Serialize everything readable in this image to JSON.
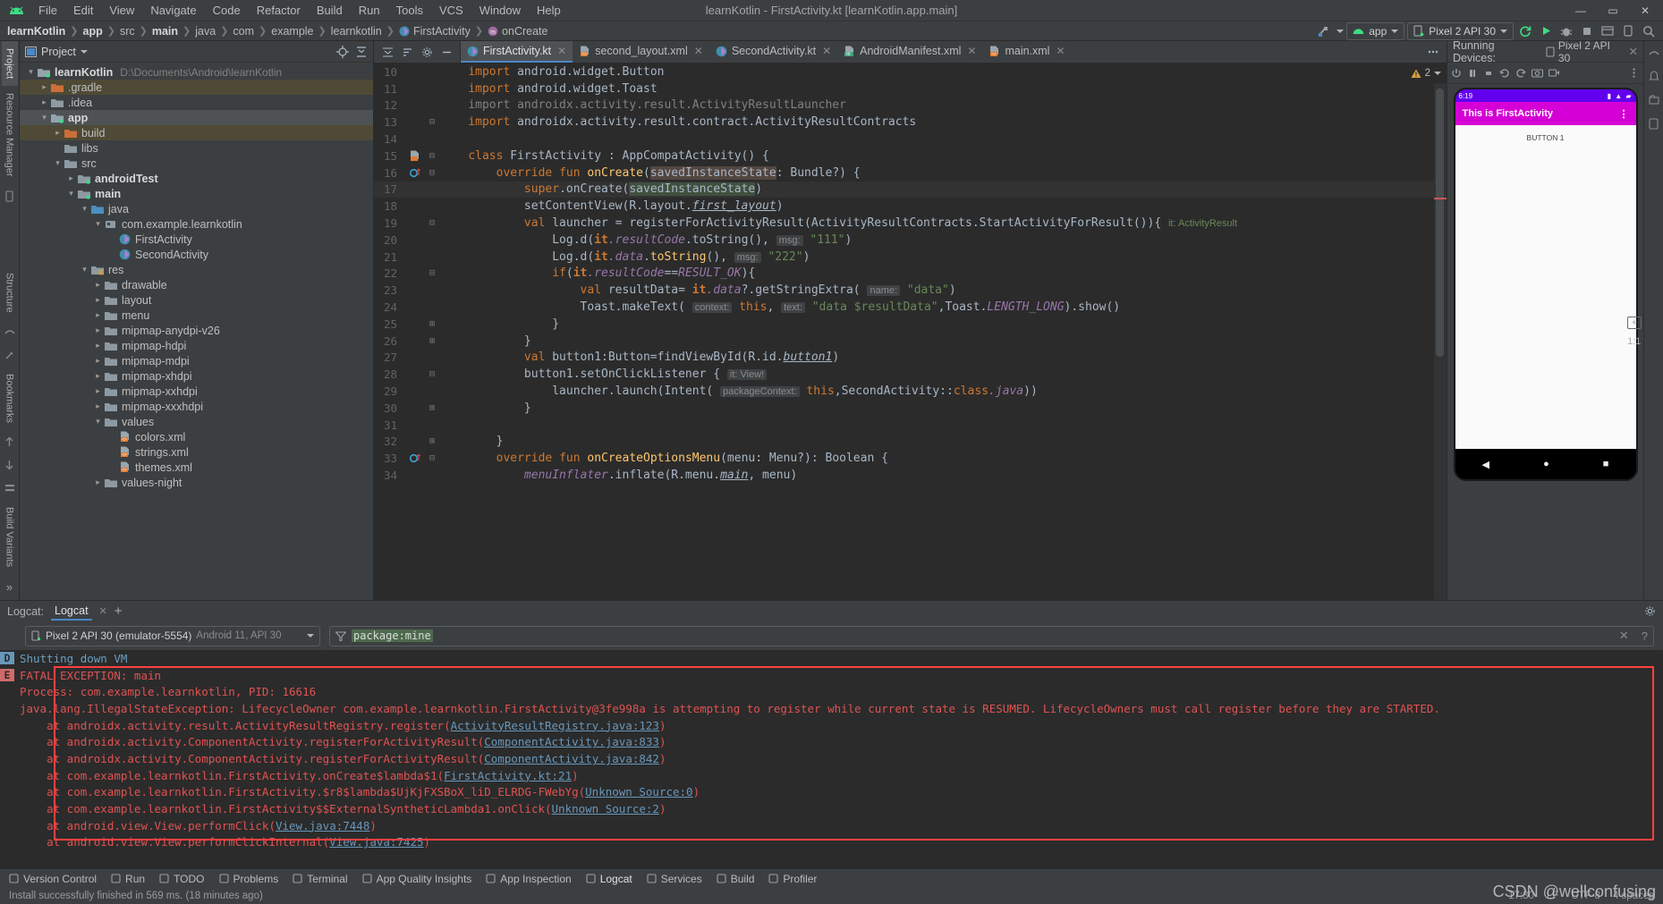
{
  "window": {
    "title": "learnKotlin - FirstActivity.kt [learnKotlin.app.main]",
    "minimize": "—",
    "maximize": "▭",
    "close": "✕"
  },
  "menu": [
    {
      "label": "File"
    },
    {
      "label": "Edit"
    },
    {
      "label": "View"
    },
    {
      "label": "Navigate"
    },
    {
      "label": "Code"
    },
    {
      "label": "Refactor"
    },
    {
      "label": "Build"
    },
    {
      "label": "Run"
    },
    {
      "label": "Tools"
    },
    {
      "label": "VCS"
    },
    {
      "label": "Window"
    },
    {
      "label": "Help"
    }
  ],
  "breadcrumb": [
    {
      "label": "learnKotlin",
      "bold": true
    },
    {
      "label": "app",
      "bold": true
    },
    {
      "label": "src",
      "bold": false
    },
    {
      "label": "main",
      "bold": true
    },
    {
      "label": "java",
      "bold": false
    },
    {
      "label": "com",
      "bold": false
    },
    {
      "label": "example",
      "bold": false
    },
    {
      "label": "learnkotlin",
      "bold": false
    },
    {
      "label": "FirstActivity",
      "bold": false
    },
    {
      "label": "onCreate",
      "bold": false
    }
  ],
  "toolbar": {
    "run_config": "app",
    "device": "Pixel 2 API 30",
    "sync_icon": "gradle-sync-icon",
    "run_icon": "run-icon",
    "debug_icon": "debug-icon",
    "search_icon": "search-icon"
  },
  "left_strip": [
    {
      "label": "Project",
      "selected": true
    },
    {
      "label": "Resource Manager",
      "selected": false
    }
  ],
  "bottom_left_strip": [
    {
      "label": "Structure"
    },
    {
      "label": "Bookmarks"
    },
    {
      "label": "Build Variants"
    }
  ],
  "project": {
    "title": "Project",
    "tree": [
      {
        "indent": 0,
        "arrow": "v",
        "icon": "module-icon",
        "label": "learnKotlin",
        "bold": true,
        "path": "D:\\Documents\\Android\\learnKotlin",
        "state": "normal"
      },
      {
        "indent": 1,
        "arrow": ">",
        "icon": "folder-excluded-icon",
        "label": ".gradle",
        "bold": false,
        "path": "",
        "state": "hl"
      },
      {
        "indent": 1,
        "arrow": ">",
        "icon": "folder-icon",
        "label": ".idea",
        "bold": false,
        "path": "",
        "state": "normal"
      },
      {
        "indent": 1,
        "arrow": "v",
        "icon": "module-icon",
        "label": "app",
        "bold": true,
        "path": "",
        "state": "sel"
      },
      {
        "indent": 2,
        "arrow": ">",
        "icon": "folder-excluded-icon",
        "label": "build",
        "bold": false,
        "path": "",
        "state": "hl"
      },
      {
        "indent": 2,
        "arrow": "",
        "icon": "folder-icon",
        "label": "libs",
        "bold": false,
        "path": "",
        "state": "normal"
      },
      {
        "indent": 2,
        "arrow": "v",
        "icon": "folder-icon",
        "label": "src",
        "bold": false,
        "path": "",
        "state": "normal"
      },
      {
        "indent": 3,
        "arrow": ">",
        "icon": "source-folder-icon",
        "label": "androidTest",
        "bold": true,
        "path": "",
        "state": "normal"
      },
      {
        "indent": 3,
        "arrow": "v",
        "icon": "source-folder-icon",
        "label": "main",
        "bold": true,
        "path": "",
        "state": "normal"
      },
      {
        "indent": 4,
        "arrow": "v",
        "icon": "java-folder-icon",
        "label": "java",
        "bold": false,
        "path": "",
        "state": "normal"
      },
      {
        "indent": 5,
        "arrow": "v",
        "icon": "package-icon",
        "label": "com.example.learnkotlin",
        "bold": false,
        "path": "",
        "state": "normal"
      },
      {
        "indent": 6,
        "arrow": "",
        "icon": "kotlin-class-icon",
        "label": "FirstActivity",
        "bold": false,
        "path": "",
        "state": "normal"
      },
      {
        "indent": 6,
        "arrow": "",
        "icon": "kotlin-class-icon",
        "label": "SecondActivity",
        "bold": false,
        "path": "",
        "state": "normal"
      },
      {
        "indent": 4,
        "arrow": "v",
        "icon": "res-folder-icon",
        "label": "res",
        "bold": false,
        "path": "",
        "state": "normal"
      },
      {
        "indent": 5,
        "arrow": ">",
        "icon": "folder-icon",
        "label": "drawable",
        "bold": false,
        "path": "",
        "state": "normal"
      },
      {
        "indent": 5,
        "arrow": ">",
        "icon": "folder-icon",
        "label": "layout",
        "bold": false,
        "path": "",
        "state": "normal"
      },
      {
        "indent": 5,
        "arrow": ">",
        "icon": "folder-icon",
        "label": "menu",
        "bold": false,
        "path": "",
        "state": "normal"
      },
      {
        "indent": 5,
        "arrow": ">",
        "icon": "folder-icon",
        "label": "mipmap-anydpi-v26",
        "bold": false,
        "path": "",
        "state": "normal"
      },
      {
        "indent": 5,
        "arrow": ">",
        "icon": "folder-icon",
        "label": "mipmap-hdpi",
        "bold": false,
        "path": "",
        "state": "normal"
      },
      {
        "indent": 5,
        "arrow": ">",
        "icon": "folder-icon",
        "label": "mipmap-mdpi",
        "bold": false,
        "path": "",
        "state": "normal"
      },
      {
        "indent": 5,
        "arrow": ">",
        "icon": "folder-icon",
        "label": "mipmap-xhdpi",
        "bold": false,
        "path": "",
        "state": "normal"
      },
      {
        "indent": 5,
        "arrow": ">",
        "icon": "folder-icon",
        "label": "mipmap-xxhdpi",
        "bold": false,
        "path": "",
        "state": "normal"
      },
      {
        "indent": 5,
        "arrow": ">",
        "icon": "folder-icon",
        "label": "mipmap-xxxhdpi",
        "bold": false,
        "path": "",
        "state": "normal"
      },
      {
        "indent": 5,
        "arrow": "v",
        "icon": "folder-icon",
        "label": "values",
        "bold": false,
        "path": "",
        "state": "normal"
      },
      {
        "indent": 6,
        "arrow": "",
        "icon": "xml-file-icon",
        "label": "colors.xml",
        "bold": false,
        "path": "",
        "state": "normal"
      },
      {
        "indent": 6,
        "arrow": "",
        "icon": "xml-file-icon",
        "label": "strings.xml",
        "bold": false,
        "path": "",
        "state": "normal"
      },
      {
        "indent": 6,
        "arrow": "",
        "icon": "xml-file-icon",
        "label": "themes.xml",
        "bold": false,
        "path": "",
        "state": "normal"
      },
      {
        "indent": 5,
        "arrow": ">",
        "icon": "folder-icon",
        "label": "values-night",
        "bold": false,
        "path": "",
        "state": "normal"
      }
    ]
  },
  "editor": {
    "tabs": [
      {
        "label": "FirstActivity.kt",
        "icon": "kotlin-class-icon",
        "active": true
      },
      {
        "label": "second_layout.xml",
        "icon": "xml-file-icon",
        "active": false
      },
      {
        "label": "SecondActivity.kt",
        "icon": "kotlin-class-icon",
        "active": false
      },
      {
        "label": "AndroidManifest.xml",
        "icon": "manifest-file-icon",
        "active": false
      },
      {
        "label": "main.xml",
        "icon": "xml-file-icon",
        "active": false
      }
    ],
    "warning_count": "2",
    "lines": [
      {
        "num": "10",
        "gutter": "",
        "fold": "",
        "html": "    <span class='kw'>import</span> <span class='plain'>android.widget.Button</span>"
      },
      {
        "num": "11",
        "gutter": "",
        "fold": "",
        "html": "    <span class='kw'>import</span> <span class='plain'>android.widget.Toast</span>"
      },
      {
        "num": "12",
        "gutter": "",
        "fold": "",
        "html": "    <span class='cmt'>import androidx.activity.result.ActivityResultLauncher</span>"
      },
      {
        "num": "13",
        "gutter": "",
        "fold": "-",
        "html": "    <span class='kw'>import</span> <span class='plain'>androidx.activity.result.contract.ActivityResultContracts</span>"
      },
      {
        "num": "14",
        "gutter": "",
        "fold": "",
        "html": ""
      },
      {
        "num": "15",
        "gutter": "layout-icon",
        "fold": "-",
        "html": "    <span class='kw'>class </span><span class='plain'>FirstActivity : AppCompatActivity() {</span>"
      },
      {
        "num": "16",
        "gutter": "override-icon",
        "fold": "-",
        "html": "        <span class='kw'>override fun </span><span class='fn'>onCreate</span><span class='plain'>(</span><span class='hlident'>savedInstanceState</span><span class='plain'>: Bundle?) {</span>"
      },
      {
        "num": "17",
        "gutter": "",
        "fold": "",
        "cur": true,
        "html": "            <span class='kw'>super</span><span class='plain'>.onCreate(</span><span class='hlgreen'>savedInstanceState</span><span class='plain'>)</span>"
      },
      {
        "num": "18",
        "gutter": "",
        "fold": "",
        "html": "            <span class='plain'>setContentView(R.layout.</span><span class='lnk'>first_layout</span><span class='plain'>)</span>"
      },
      {
        "num": "19",
        "gutter": "",
        "fold": "-",
        "html": "            <span class='kw'>val </span><span class='plain'>launcher = registerForActivityResult(ActivityResultContracts.StartActivityForResult()){ </span><span class='hint2'>it: ActivityResult</span>"
      },
      {
        "num": "20",
        "gutter": "",
        "fold": "",
        "html": "                <span class='plain'>Log.d(</span><span class='kwb'>it</span><span class='fldi'>.resultCode</span><span class='plain'>.toString(), </span><span class='hint'>msg:</span> <span class='str'>\"111\"</span><span class='plain'>)</span>"
      },
      {
        "num": "21",
        "gutter": "",
        "fold": "",
        "html": "                <span class='plain'>Log.d(</span><span class='kwb'>it</span><span class='fldi'>.data</span><span class='plain'>.</span><span class='fn'>toString</span><span class='plain'>(), </span><span class='hint'>msg:</span> <span class='str'>\"222\"</span><span class='plain'>)</span>"
      },
      {
        "num": "22",
        "gutter": "",
        "fold": "-",
        "html": "                <span class='kw'>if</span><span class='plain'>(</span><span class='kwb'>it</span><span class='fldi'>.resultCode</span><span class='plain'>==</span><span class='cnst'>RESULT_OK</span><span class='plain'>){</span>"
      },
      {
        "num": "23",
        "gutter": "",
        "fold": "",
        "html": "                    <span class='kw'>val </span><span class='plain'>resultData= </span><span class='kwb'>it</span><span class='fldi'>.data</span><span class='plain'>?.getStringExtra( </span><span class='hint'>name:</span> <span class='str'>\"data\"</span><span class='plain'>)</span>"
      },
      {
        "num": "24",
        "gutter": "",
        "fold": "",
        "html": "                    <span class='plain'>Toast.makeText( </span><span class='hint'>context:</span> <span class='kw'>this</span><span class='plain'>, </span><span class='hint'>text:</span> <span class='str'>\"data $resultData\"</span><span class='plain'>,Toast.</span><span class='cnst'>LENGTH_LONG</span><span class='plain'>).show()</span>"
      },
      {
        "num": "25",
        "gutter": "",
        "fold": "+",
        "html": "                <span class='plain'>}</span>"
      },
      {
        "num": "26",
        "gutter": "",
        "fold": "+",
        "html": "            <span class='plain'>}</span>"
      },
      {
        "num": "27",
        "gutter": "",
        "fold": "",
        "html": "            <span class='kw'>val </span><span class='plain'>button1:Button=findViewById(R.id.</span><span class='lnk'>button1</span><span class='plain'>)</span>"
      },
      {
        "num": "28",
        "gutter": "",
        "fold": "-",
        "html": "            <span class='plain'>button1.setOnClickListener { </span><span class='hint'>it: View!</span>"
      },
      {
        "num": "29",
        "gutter": "",
        "fold": "",
        "html": "                <span class='plain'>launcher.launch(Intent( </span><span class='hint'>packageContext:</span> <span class='kw'>this</span><span class='plain'>,SecondActivity::</span><span class='kw'>class</span><span class='fldi'>.java</span><span class='plain'>))</span>"
      },
      {
        "num": "30",
        "gutter": "",
        "fold": "+",
        "html": "            <span class='plain'>}</span>"
      },
      {
        "num": "31",
        "gutter": "",
        "fold": "",
        "html": ""
      },
      {
        "num": "32",
        "gutter": "",
        "fold": "+",
        "html": "        <span class='plain'>}</span>"
      },
      {
        "num": "33",
        "gutter": "override-icon",
        "fold": "-",
        "html": "        <span class='kw'>override fun </span><span class='fn'>onCreateOptionsMenu</span><span class='plain'>(menu: Menu?): Boolean {</span>"
      },
      {
        "num": "34",
        "gutter": "",
        "fold": "",
        "html": "            <span class='fldi'>menuInflater</span><span class='plain'>.inflate(R.menu.</span><span class='lnk'>main</span><span class='plain'>, menu)</span>"
      }
    ]
  },
  "emulator": {
    "panel_title": "Running Devices:",
    "device_tab": "Pixel 2 API 30",
    "status_time": "6:19",
    "app_title": "This is FirstActivity",
    "button_label": "BUTTON 1",
    "zoom_level": "1:1",
    "zoom_in": "+",
    "overflow_icon": "more-vert-icon",
    "nav_back": "back-icon",
    "nav_home": "home-icon",
    "nav_recents": "recents-icon"
  },
  "logcat": {
    "panel_label": "Logcat:",
    "tab_label": "Logcat",
    "add_tab": "+",
    "device": "Pixel 2 API 30 (emulator-5554)",
    "device_sub": "Android 11, API 30",
    "filter_value": "package:mine",
    "filter_icon": "filter-icon",
    "clear_icon": "clear-icon",
    "help_icon": "help-icon",
    "lines": [
      {
        "level": "D",
        "text": "Shutting down VM",
        "indent": 0,
        "link": null,
        "boxed": false
      },
      {
        "level": "E",
        "text": "FATAL EXCEPTION: main",
        "indent": 0,
        "link": null,
        "boxed": true
      },
      {
        "level": "",
        "text": "Process: com.example.learnkotlin, PID: 16616",
        "indent": 0,
        "link": null,
        "boxed": true
      },
      {
        "level": "",
        "text": "java.lang.IllegalStateException: LifecycleOwner com.example.learnkotlin.FirstActivity@3fe998a is attempting to register while current state is RESUMED. LifecycleOwners must call register before they are STARTED.",
        "indent": 0,
        "link": null,
        "boxed": true
      },
      {
        "level": "",
        "text": "at androidx.activity.result.ActivityResultRegistry.register(",
        "indent": 1,
        "link": "ActivityResultRegistry.java:123",
        "tail": ")",
        "boxed": true
      },
      {
        "level": "",
        "text": "at androidx.activity.ComponentActivity.registerForActivityResult(",
        "indent": 1,
        "link": "ComponentActivity.java:833",
        "tail": ")",
        "boxed": true
      },
      {
        "level": "",
        "text": "at androidx.activity.ComponentActivity.registerForActivityResult(",
        "indent": 1,
        "link": "ComponentActivity.java:842",
        "tail": ")",
        "boxed": true
      },
      {
        "level": "",
        "text": "at com.example.learnkotlin.FirstActivity.onCreate$lambda$1(",
        "indent": 1,
        "link": "FirstActivity.kt:21",
        "tail": ")",
        "boxed": true
      },
      {
        "level": "",
        "text": "at com.example.learnkotlin.FirstActivity.$r8$lambda$UjKjFXSBoX_liD_ELRDG-FWebYg(",
        "indent": 1,
        "link": "Unknown Source:0",
        "tail": ")",
        "boxed": true
      },
      {
        "level": "",
        "text": "at com.example.learnkotlin.FirstActivity$$ExternalSyntheticLambda1.onClick(",
        "indent": 1,
        "link": "Unknown Source:2",
        "tail": ")",
        "boxed": true
      },
      {
        "level": "",
        "text": "at android.view.View.performClick(",
        "indent": 1,
        "link": "View.java:7448",
        "tail": ")",
        "boxed": true
      },
      {
        "level": "",
        "text": "at android.view.View.performClickInternal(",
        "indent": 1,
        "link": "View.java:7425",
        "tail": ")",
        "boxed": true
      }
    ]
  },
  "statusbar": {
    "items": [
      {
        "label": "Version Control",
        "icon": "branch-icon"
      },
      {
        "label": "Run",
        "icon": "run-icon"
      },
      {
        "label": "TODO",
        "icon": "todo-icon"
      },
      {
        "label": "Problems",
        "icon": "problems-icon"
      },
      {
        "label": "Terminal",
        "icon": "terminal-icon"
      },
      {
        "label": "App Quality Insights",
        "icon": "insights-icon"
      },
      {
        "label": "App Inspection",
        "icon": "inspection-icon"
      },
      {
        "label": "Logcat",
        "icon": "logcat-icon",
        "active": true
      },
      {
        "label": "Services",
        "icon": "services-icon"
      },
      {
        "label": "Build",
        "icon": "build-icon"
      },
      {
        "label": "Profiler",
        "icon": "profiler-icon"
      }
    ],
    "build_message": "Install successfully finished in 569 ms. (18 minutes ago)",
    "position": "17:30",
    "line_sep": "LF",
    "encoding": "UTF-8",
    "indent": "4 spaces"
  },
  "watermark": {
    "line1": "CSDN @wellconfusing"
  },
  "colors": {
    "accent": "#4a88c7",
    "error": "#e05252",
    "error_border": "#ff4040",
    "editor_bg": "#2b2b2b",
    "panel_bg": "#3c3f41",
    "appbar": "#d500d5"
  }
}
